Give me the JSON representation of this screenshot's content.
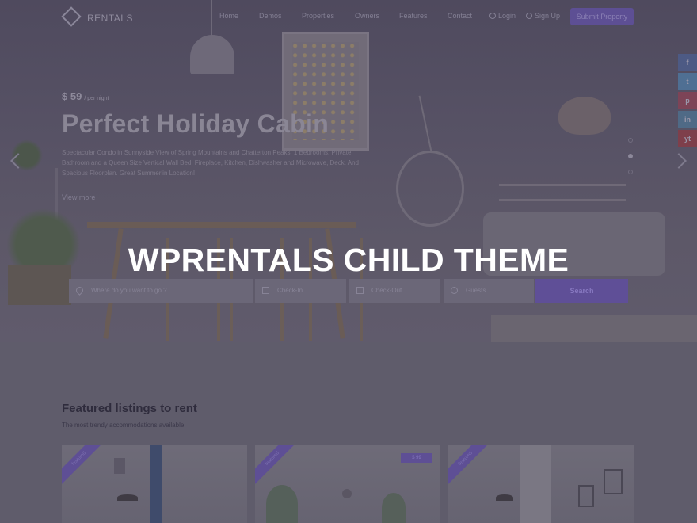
{
  "nav": {
    "logo_text": "RENTALS",
    "links": [
      "Home",
      "Demos",
      "Properties",
      "Owners",
      "Features",
      "Contact"
    ],
    "login": "Login",
    "signup": "Sign Up",
    "submit": "Submit Property"
  },
  "hero": {
    "price": "$ 59",
    "price_unit": "/ per night",
    "title": "Perfect Holiday Cabin",
    "description": "Spectacular Condo in Sunnyside View of Spring Mountains and Chatterton Peaks! 1 Bedrooms, Private Bathroom and a Queen Size Vertical Wall Bed, Fireplace, Kitchen, Dishwasher and Microwave, Deck. And Spacious Floorplan. Great Summerlin Location!",
    "view_more": "View more",
    "slide_count": 3,
    "active_slide": 2
  },
  "overlay_title": "WPRENTALS CHILD THEME",
  "search": {
    "where_placeholder": "Where do you want to go ?",
    "checkin_placeholder": "Check-In",
    "checkout_placeholder": "Check-Out",
    "guests_placeholder": "Guests",
    "button": "Search"
  },
  "social": [
    "f",
    "t",
    "p",
    "in",
    "yt"
  ],
  "featured": {
    "title": "Featured listings to rent",
    "subtitle": "The most trendy accommodations available",
    "cards": [
      {
        "ribbon": "featured",
        "tag": ""
      },
      {
        "ribbon": "featured",
        "tag": "$ 99"
      },
      {
        "ribbon": "featured",
        "tag": ""
      }
    ]
  },
  "colors": {
    "overlay": "#5e5b6b",
    "accent": "#5e4f95",
    "title_text": "#ffffff"
  }
}
